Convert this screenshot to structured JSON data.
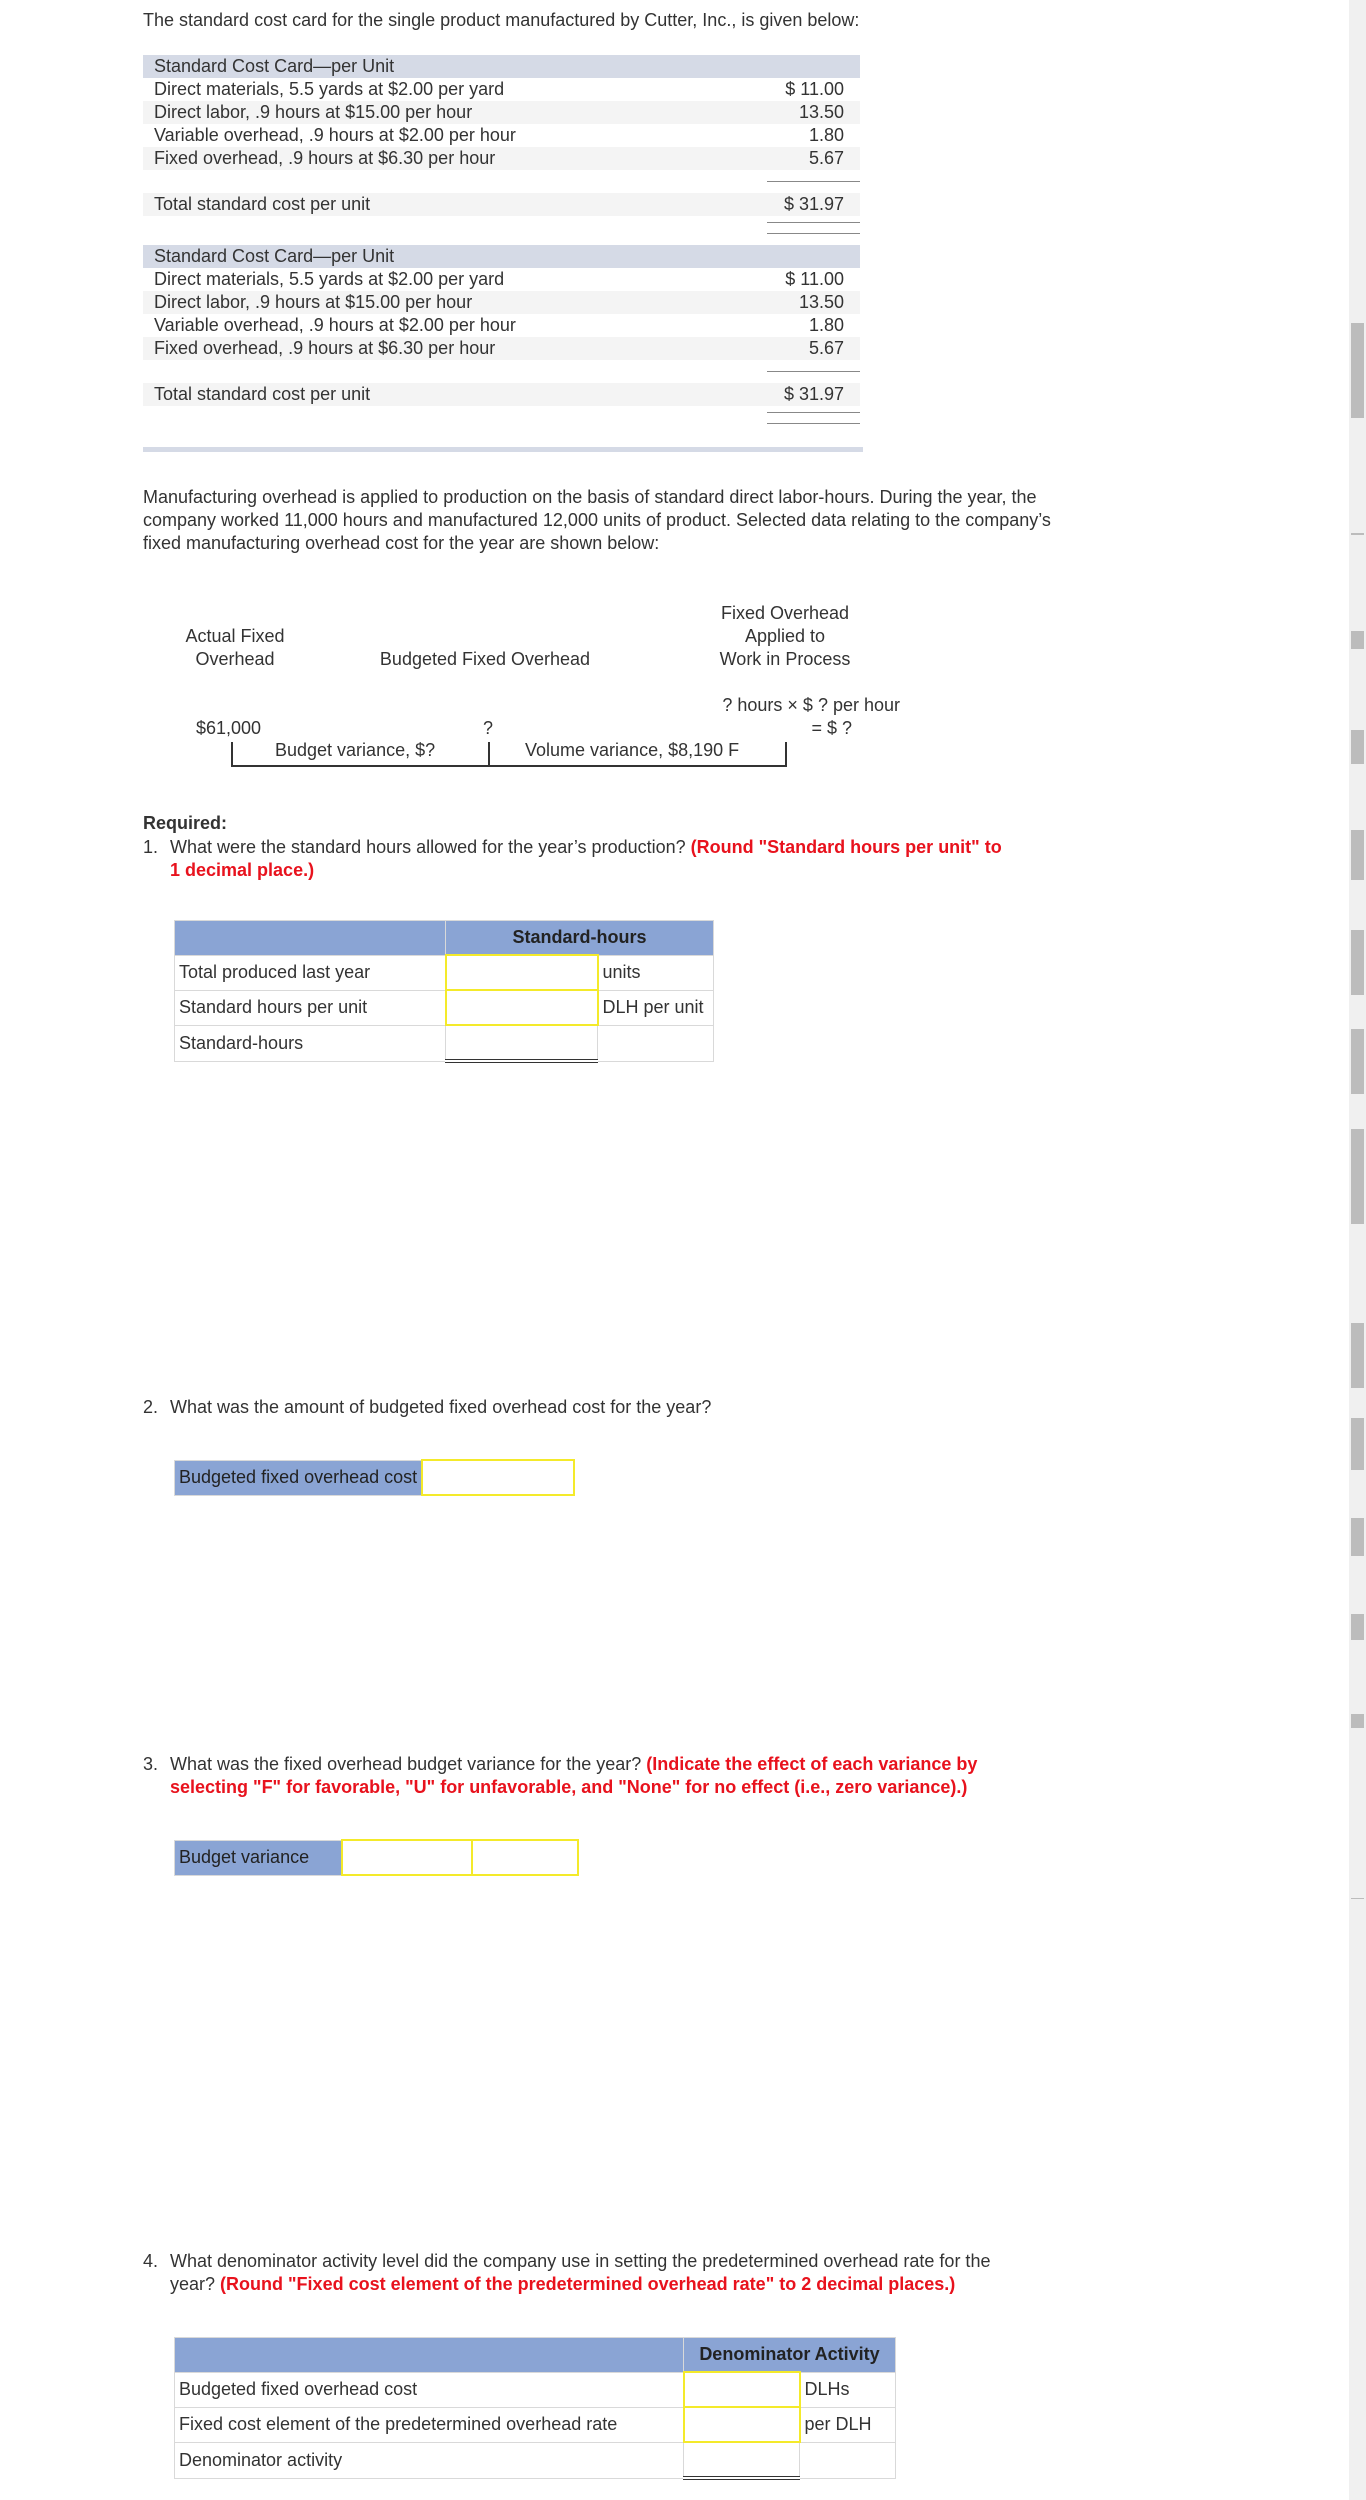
{
  "intro": "The standard cost card for the single product manufactured by Cutter, Inc., is given below:",
  "cost_card": {
    "title": "Standard Cost Card—per Unit",
    "rows": [
      {
        "label": "Direct materials, 5.5 yards at $2.00 per yard",
        "amount": "$ 11.00"
      },
      {
        "label": "Direct labor, .9 hours at $15.00 per hour",
        "amount": "13.50"
      },
      {
        "label": "Variable overhead, .9 hours at $2.00 per hour",
        "amount": "1.80"
      },
      {
        "label": "Fixed overhead, .9 hours at $6.30 per hour",
        "amount": "5.67"
      }
    ],
    "total_label": "Total standard cost per unit",
    "total_amount": "$ 31.97"
  },
  "paragraph": "Manufacturing overhead is applied to production on the basis of standard direct labor-hours. During the year, the company worked 11,000 hours and manufactured 12,000 units of product. Selected data relating to the company’s fixed manufacturing overhead cost for the year are shown below:",
  "diagram": {
    "col1_line1": "Actual Fixed",
    "col1_line2": "Overhead",
    "col2": "Budgeted Fixed Overhead",
    "col3_line1": "Fixed Overhead",
    "col3_line2": "Applied to",
    "col3_line3": "Work in Process",
    "formula_line1": "? hours × $ ? per hour",
    "formula_line2": "= $ ?",
    "actual_value": "$61,000",
    "budget_value": "?",
    "budget_variance": "Budget variance, $?",
    "volume_variance": "Volume variance, $8,190 F"
  },
  "required_label": "Required:",
  "questions": [
    {
      "number": "1.",
      "text": "What were the standard hours allowed for the year’s production?",
      "instruction_line1": "(Round \"Standard hours per unit\" to",
      "instruction_line2": "1 decimal place.)",
      "table": {
        "header": "Standard-hours",
        "rows": [
          {
            "label": "Total produced last year",
            "value": "",
            "unit": "units"
          },
          {
            "label": "Standard hours per unit",
            "value": "",
            "unit": "DLH per unit"
          },
          {
            "label": "Standard-hours",
            "value": "",
            "unit": ""
          }
        ]
      }
    },
    {
      "number": "2.",
      "text": "What was the amount of budgeted fixed overhead cost for the year?",
      "table": {
        "label": "Budgeted fixed overhead cost",
        "value": ""
      }
    },
    {
      "number": "3.",
      "text": "What was the fixed overhead budget variance for the year?",
      "instruction_line1": "(Indicate the effect of each variance by",
      "instruction_line2": "selecting \"F\" for favorable, \"U\" for unfavorable, and \"None\" for no effect (i.e., zero variance).)",
      "table": {
        "label": "Budget variance",
        "amount": "",
        "effect": ""
      }
    },
    {
      "number": "4.",
      "text": "What denominator activity level did the company use in setting the predetermined overhead rate for the",
      "text_line2": "year?",
      "instruction": "(Round \"Fixed cost element of the predetermined overhead rate\" to 2 decimal places.)",
      "table": {
        "header": "Denominator Activity",
        "rows": [
          {
            "label": "Budgeted fixed overhead cost",
            "value": "",
            "unit": "DLHs"
          },
          {
            "label": "Fixed cost element of the predetermined overhead rate",
            "value": "",
            "unit": "per DLH"
          },
          {
            "label": "Denominator activity",
            "value": "",
            "unit": ""
          }
        ]
      }
    }
  ]
}
